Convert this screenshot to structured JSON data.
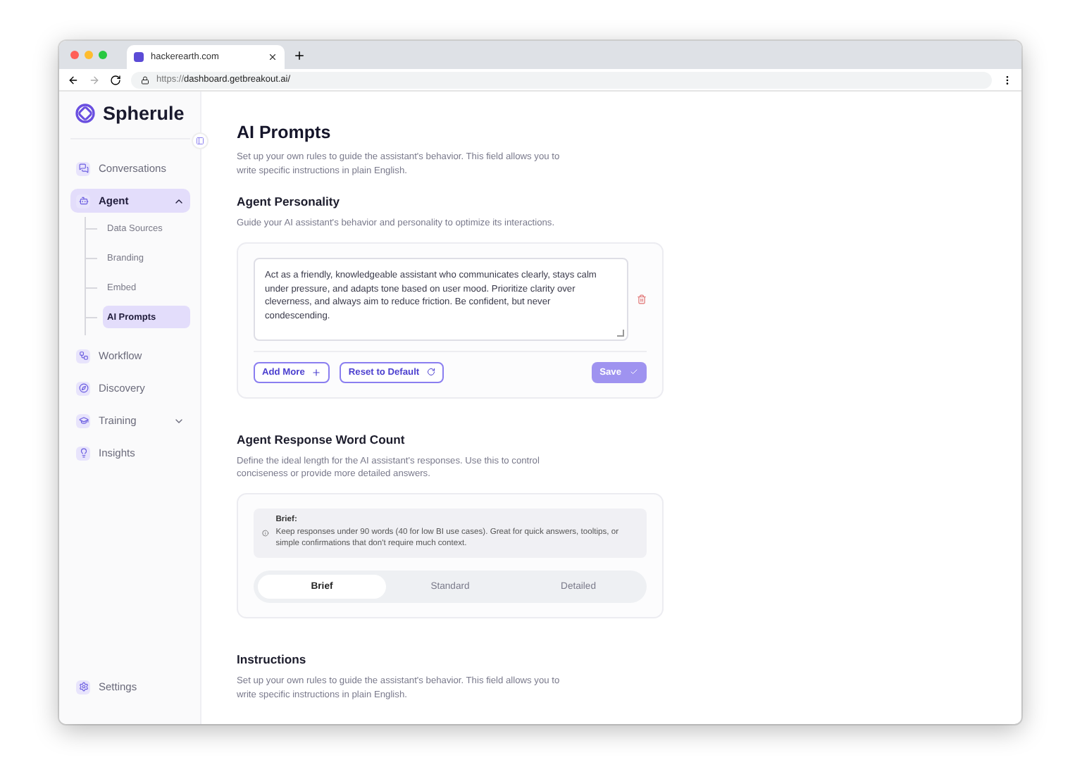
{
  "browser": {
    "tab_title": "hackerearth.com",
    "url_scheme": "https://",
    "url_host": "dashboard.getbreakout.ai/"
  },
  "sidebar": {
    "logo": "Spherule",
    "items": [
      {
        "label": "Conversations",
        "selected": false
      },
      {
        "label": "Agent",
        "selected": true,
        "expanded": true,
        "children": [
          {
            "label": "Data Sources",
            "selected": false
          },
          {
            "label": "Branding",
            "selected": false
          },
          {
            "label": "Embed",
            "selected": false
          },
          {
            "label": "AI Prompts",
            "selected": true
          }
        ]
      },
      {
        "label": "Workflow",
        "selected": false
      },
      {
        "label": "Discovery",
        "selected": false
      },
      {
        "label": "Training",
        "selected": false,
        "expanded": false
      },
      {
        "label": "Insights",
        "selected": false
      }
    ],
    "footer_items": [
      {
        "label": "Settings",
        "selected": false
      }
    ]
  },
  "page": {
    "title": "AI Prompts",
    "description": "Set up your own rules to guide the assistant's behavior. This field allows you to write specific instructions in plain English."
  },
  "personality": {
    "heading": "Agent Personality",
    "description": "Guide your AI assistant's behavior and personality to optimize its interactions.",
    "prompt": "Act as a friendly, knowledgeable assistant who communicates clearly, stays calm under pressure, and adapts tone based on user mood. Prioritize clarity over cleverness, and always aim to reduce friction. Be confident, but never condescending.",
    "add_button": "Add More",
    "reset_button": "Reset to Default",
    "save_button": {
      "label": "Save",
      "disabled": true
    }
  },
  "word_count": {
    "heading": "Agent Response Word Count",
    "description": "Define the ideal length for the AI assistant's responses. Use this to control conciseness or provide more detailed answers.",
    "info_title": "Brief:",
    "info_text": "Keep responses under 90 words (40 for low BI use cases). Great for quick answers, tooltips, or simple confirmations that don't require much context.",
    "options": [
      {
        "label": "Brief",
        "selected": true
      },
      {
        "label": "Standard",
        "selected": false
      },
      {
        "label": "Detailed",
        "selected": false
      }
    ]
  },
  "instructions": {
    "heading": "Instructions",
    "description": "Set up your own rules to guide the assistant's behavior. This field allows you to write specific instructions in plain English."
  }
}
